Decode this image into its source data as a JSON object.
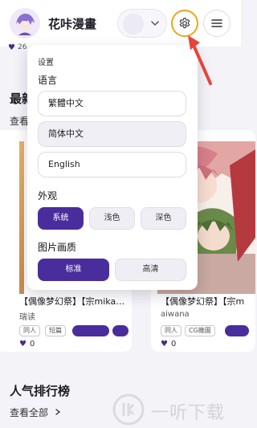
{
  "header": {
    "app_title": "花咔漫畫"
  },
  "background": {
    "strip_count": "26",
    "section_latest": {
      "title": "最新",
      "more": "查看"
    },
    "cards": [
      {
        "title": "【偶像梦幻祭】【宗mika…",
        "author": "瑞读",
        "tags": [
          "同人",
          "短篇"
        ],
        "likes": "0"
      },
      {
        "title": "【偶像梦幻祭】【宗m",
        "author": "aiwana",
        "tags": [
          "同人",
          "CG雜圖"
        ],
        "likes": "0"
      }
    ],
    "section_ranking": {
      "title": "人气排行榜",
      "more": "查看全部"
    },
    "watermark_text": "一听下载"
  },
  "settings": {
    "heading": "设置",
    "language": {
      "label": "语言",
      "options": [
        "繁體中文",
        "简体中文",
        "English"
      ],
      "selected": "简体中文"
    },
    "appearance": {
      "label": "外观",
      "options": [
        "系统",
        "浅色",
        "深色"
      ],
      "selected": "系统"
    },
    "image_quality": {
      "label": "图片画质",
      "options": [
        "标准",
        "高清"
      ],
      "selected": "标准"
    }
  },
  "colors": {
    "accent": "#4a2d9c",
    "gear_ring": "#f0a51a",
    "annotation_arrow": "#e8433a"
  },
  "icons": [
    "gear-icon",
    "menu-icon",
    "chevron-down-icon",
    "heart-icon",
    "chevron-right-icon"
  ]
}
